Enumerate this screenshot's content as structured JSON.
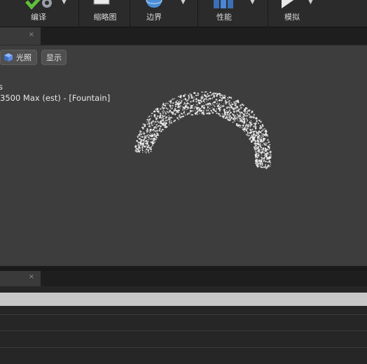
{
  "toolbar": {
    "compile_label": "编译",
    "thumbnail_label": "缩略图",
    "bounds_label": "边界",
    "performance_label": "性能",
    "simulate_label": "模拟"
  },
  "viewport": {
    "tab_close": "×",
    "lighting_label": "光照",
    "show_label": "显示",
    "stat_line1": "s",
    "stat_line2": "3500 Max (est) - [Fountain]"
  },
  "bottom": {
    "tab_close": "×"
  },
  "colors": {
    "toolbar_bg": "#2b2b2b",
    "viewport_bg": "#3d3d3d",
    "particle": "#f2f2f2"
  }
}
